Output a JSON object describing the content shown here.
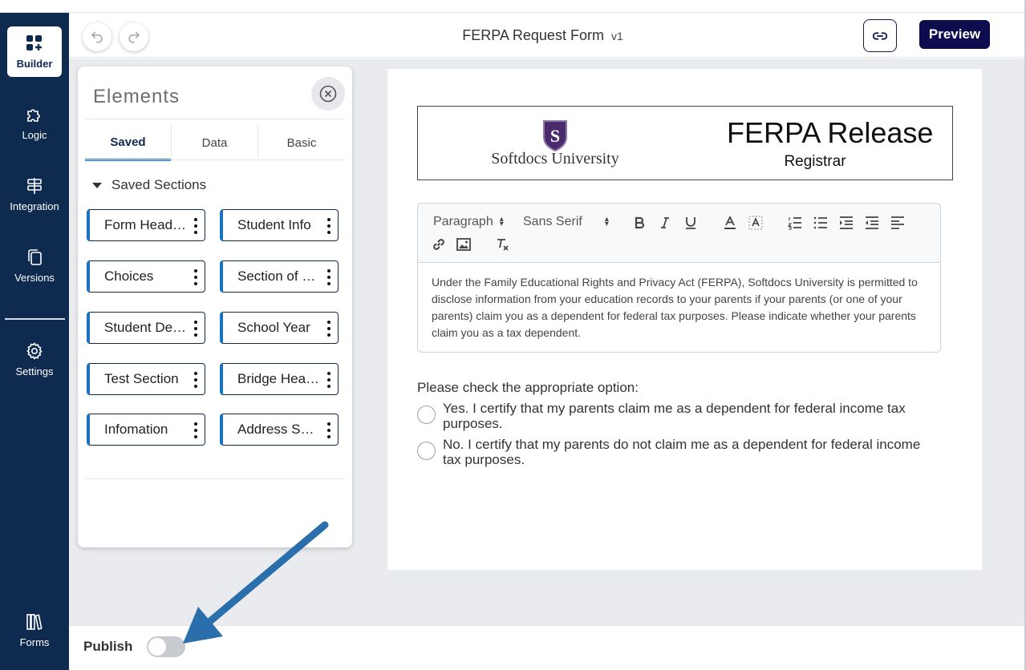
{
  "nav": {
    "builder": "Builder",
    "logic": "Logic",
    "integration": "Integration",
    "versions": "Versions",
    "settings": "Settings",
    "forms": "Forms"
  },
  "header": {
    "title": "FERPA Request Form",
    "version": "v1",
    "preview_label": "Preview"
  },
  "elements_panel": {
    "title": "Elements",
    "tabs": [
      "Saved",
      "Data",
      "Basic"
    ],
    "active_tab": "Saved",
    "section_heading": "Saved Sections",
    "saved_sections": [
      "Form Header",
      "Student Info",
      "Choices",
      "Section of Choices",
      "Student Demographics",
      "School Year",
      "Test Section",
      "Bridge Header",
      "Infomation",
      "Address Section"
    ],
    "saved_sections_display": [
      "Form Head…",
      "Student Info",
      "Choices",
      "Section of …",
      "Student De…",
      "School Year",
      "Test Section",
      "Bridge Hea…",
      "Infomation",
      "Address Se…"
    ]
  },
  "form": {
    "header": {
      "university": "Softdocs University",
      "logo_letter": "S",
      "title": "FERPA Release",
      "subtitle": "Registrar"
    },
    "editor": {
      "block_format": "Paragraph",
      "font": "Sans Serif",
      "text": "Under the Family Educational Rights and Privacy Act (FERPA), Softdocs University is permitted to disclose information from your education records to your parents if your parents (or one of your parents) claim you as a dependent for federal tax purposes. Please indicate whether your parents claim you as a tax dependent."
    },
    "question": "Please check the appropriate option:",
    "options": [
      "Yes. I certify that my parents claim me as a dependent for federal income tax purposes.",
      "No. I certify that my parents do not claim me as a dependent for federal income tax purposes."
    ]
  },
  "footer": {
    "publish_label": "Publish",
    "publish_enabled": false
  },
  "colors": {
    "nav_bg": "#0e2a4f",
    "preview_bg": "#0d0c4f",
    "accent": "#1a73c2",
    "annotation_arrow": "#2a6fab",
    "logo_purple": "#4b2a6e"
  }
}
